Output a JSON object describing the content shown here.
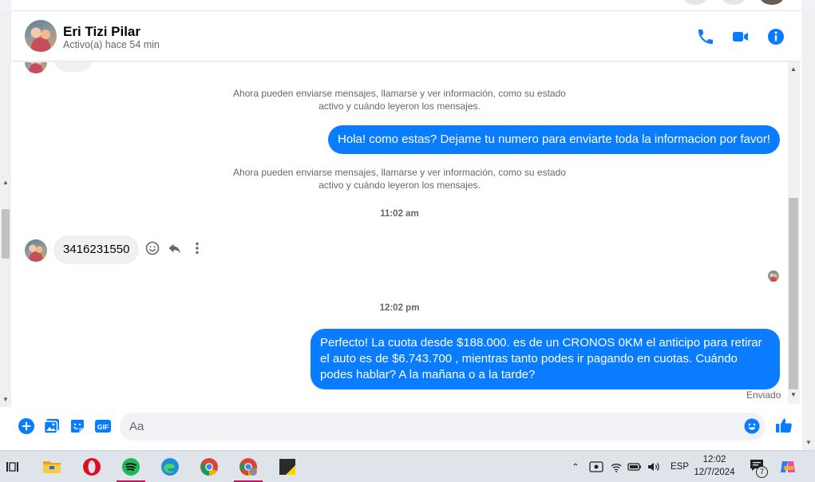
{
  "contact": {
    "name": "Eri Tizi Pilar",
    "status": "Activo(a) hace 54 min"
  },
  "header_actions": {
    "call_icon": "phone-icon",
    "video_icon": "video-camera-icon",
    "info_icon": "info-icon"
  },
  "messages": {
    "system_note_1": "Ahora pueden enviarse mensajes, llamarse y ver información, como su estado activo y cuándo leyeron los mensajes.",
    "outgoing_1": "Hola! como estas? Dejame tu numero para enviarte toda la informacion por favor!",
    "system_note_2": "Ahora pueden enviarse mensajes, llamarse y ver información, como su estado activo y cuándo leyeron los mensajes.",
    "timestamp_1": "11:02 am",
    "incoming_1": "3416231550",
    "timestamp_2": "12:02 pm",
    "outgoing_2": "Perfecto! La cuota desde $188.000. es de un CRONOS 0KM el anticipo para retirar el auto es de $6.743.700 , mientras tanto podes ir pagando en cuotas. Cuándo podes hablar? A la mañana o a la tarde?",
    "sent_label": "Enviado"
  },
  "composer": {
    "placeholder": "Aa",
    "gif_label": "GIF"
  },
  "taskbar": {
    "language": "ESP",
    "time": "12:02",
    "date": "12/7/2024",
    "notification_count": "7"
  },
  "colors": {
    "accent": "#0a7cff",
    "incoming_bubble": "#f0f0f0",
    "secondary_text": "#65676b"
  }
}
